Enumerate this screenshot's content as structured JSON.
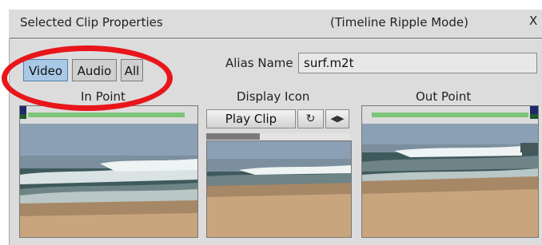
{
  "window": {
    "title": "Selected Clip Properties",
    "mode": "(Timeline Ripple Mode)",
    "close_label": "X"
  },
  "tabs": [
    {
      "label": "Video",
      "active": true
    },
    {
      "label": "Audio",
      "active": false
    },
    {
      "label": "All",
      "active": false
    }
  ],
  "alias": {
    "label": "Alias Name",
    "value": "surf.m2t"
  },
  "sections": {
    "in_point": "In Point",
    "display_icon": "Display Icon",
    "out_point": "Out Point"
  },
  "controls": {
    "play_label": "Play Clip",
    "loop_icon": "loop-icon",
    "direction_icon": "left-right-arrows-icon",
    "progress": 0.37
  },
  "colors": {
    "active_tab": "#a8c8e6",
    "marker_green": "#7cc477",
    "annotation_red": "#e8161b"
  }
}
